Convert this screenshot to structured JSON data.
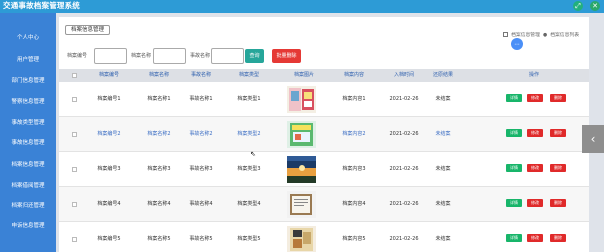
{
  "app": {
    "title": "交通事故档案管理系统"
  },
  "sidebar": {
    "items": [
      {
        "label": "个人中心"
      },
      {
        "label": "用户管理"
      },
      {
        "label": "部门信息管理"
      },
      {
        "label": "警察信息管理"
      },
      {
        "label": "事故类型管理"
      },
      {
        "label": "事故信息管理"
      },
      {
        "label": "档案信息管理"
      },
      {
        "label": "档案借阅管理"
      },
      {
        "label": "档案归还管理"
      },
      {
        "label": "申诉信息管理"
      }
    ]
  },
  "breadcrumb": {
    "button_label": "档案信息管理",
    "path_1": "档案信息管理",
    "path_2": "档案信息列表"
  },
  "search": {
    "label_1": "档案编号",
    "label_2": "档案名称",
    "label_3": "事故名称",
    "search_btn": "查询",
    "batch_delete_btn": "批量删除"
  },
  "table": {
    "headers": [
      "档案编号",
      "档案名称",
      "事故名称",
      "档案类型",
      "档案图片",
      "档案内容",
      "入档时间",
      "还原结果",
      "操作"
    ],
    "rows": [
      {
        "no": "档案编号1",
        "name": "档案名称1",
        "accident": "事故名称1",
        "type": "档案类型1",
        "content": "档案内容1",
        "date": "2021-02-26",
        "result": "未结案"
      },
      {
        "no": "档案编号2",
        "name": "档案名称2",
        "accident": "事故名称2",
        "type": "档案类型2",
        "content": "档案内容2",
        "date": "2021-02-26",
        "result": "未结案"
      },
      {
        "no": "档案编号3",
        "name": "档案名称3",
        "accident": "事故名称3",
        "type": "档案类型3",
        "content": "档案内容3",
        "date": "2021-02-26",
        "result": "未结案"
      },
      {
        "no": "档案编号4",
        "name": "档案名称4",
        "accident": "事故名称4",
        "type": "档案类型4",
        "content": "档案内容4",
        "date": "2021-02-26",
        "result": "未结案"
      },
      {
        "no": "档案编号5",
        "name": "档案名称5",
        "accident": "事故名称5",
        "type": "档案类型5",
        "content": "档案内容5",
        "date": "2021-02-26",
        "result": "未结案"
      }
    ],
    "actions": {
      "detail": "详情",
      "edit": "修改",
      "delete": "删除"
    }
  },
  "colors": {
    "header_blue": "#2d9bd6",
    "sidebar_blue": "#3a82d6",
    "success": "#18b56a",
    "danger": "#e02a2a"
  }
}
